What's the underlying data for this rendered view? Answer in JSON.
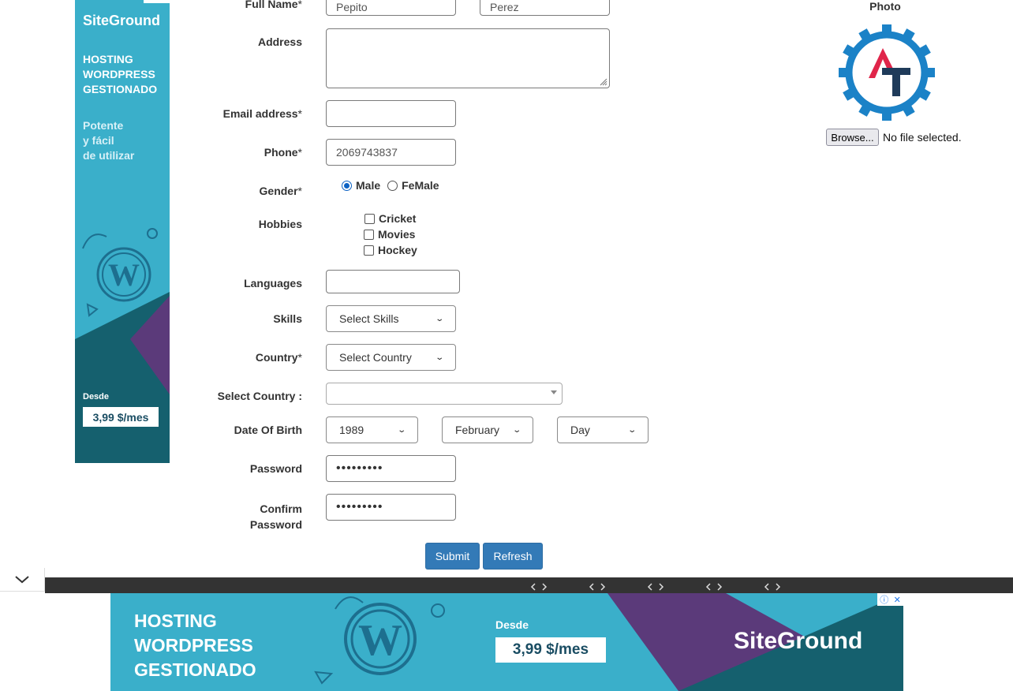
{
  "form": {
    "full_name_label": "Full Name",
    "first_name": "Pepito",
    "last_name": "Perez",
    "address_label": "Address",
    "email_label": "Email address",
    "phone_label": "Phone",
    "phone_value": "2069743837",
    "gender_label": "Gender",
    "gender_options": [
      "Male",
      "FeMale"
    ],
    "hobbies_label": "Hobbies",
    "hobbies": [
      "Cricket",
      "Movies",
      "Hockey"
    ],
    "languages_label": "Languages",
    "skills_label": "Skills",
    "skills_value": "Select Skills",
    "country_label": "Country",
    "country_value": "Select Country",
    "select_country_label": "Select Country :",
    "dob_label": "Date Of Birth",
    "dob_year": "1989",
    "dob_month": "February",
    "dob_day": "Day",
    "password_label": "Password",
    "password_mask": "•••••••••",
    "confirm_label_1": "Confirm",
    "confirm_label_2": "Password",
    "confirm_mask": "•••••••••",
    "required_mark": "*",
    "submit": "Submit",
    "refresh": "Refresh"
  },
  "photo": {
    "label": "Photo",
    "browse": "Browse...",
    "no_file": "No file selected."
  },
  "side_ad": {
    "brand": "SiteGround",
    "headline": [
      "HOSTING",
      "WORDPRESS",
      "GESTIONADO"
    ],
    "sub": [
      "Potente",
      "y fácil",
      "de utilizar"
    ],
    "desde": "Desde",
    "price": "3,99 $/mes"
  },
  "bottom_ad": {
    "headline": [
      "HOSTING",
      "WORDPRESS",
      "GESTIONADO"
    ],
    "desde": "Desde",
    "price": "3,99 $/mes",
    "brand": "SiteGround"
  },
  "colors": {
    "primary": "#337ab7",
    "ad_bg": "#3aafca",
    "ad_purple": "#5b3a7a",
    "ad_dark": "#15606e",
    "logo_blue": "#1b82c7",
    "logo_red": "#e0254a",
    "logo_navy": "#1f3b5a"
  }
}
